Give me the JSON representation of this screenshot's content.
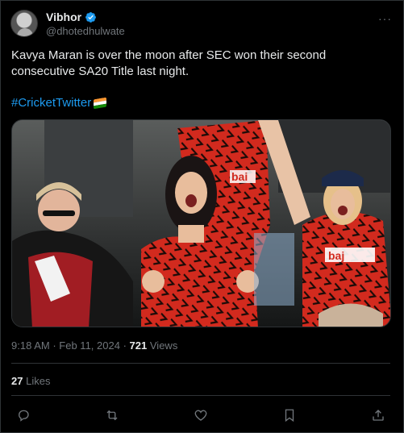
{
  "author": {
    "name": "Vibhor",
    "handle": "@dhotedhulwate",
    "verified_icon": "verified-badge-icon",
    "avatar_icon": "avatar-photo"
  },
  "tweet": {
    "text": "Kavya Maran is over the moon after SEC won their second consecutive SA20 Title last night.",
    "hashtag": "#CricketTwitter",
    "hashtag_emoji": "flag-icon"
  },
  "media": {
    "jersey_text_left": "bai",
    "jersey_text_right": "baj",
    "colors": {
      "jersey": "#d22a1e",
      "pattern": "#1a0b08"
    }
  },
  "meta": {
    "time": "9:18 AM",
    "separator": "·",
    "date": "Feb 11, 2024",
    "views_count": "721",
    "views_label": "Views"
  },
  "engagement": {
    "likes_count": "27",
    "likes_label": "Likes"
  },
  "colors": {
    "background": "#000000",
    "accent": "#1d9bf0",
    "text": "#e7e9ea",
    "muted": "#71767b",
    "border": "#2f3336"
  }
}
